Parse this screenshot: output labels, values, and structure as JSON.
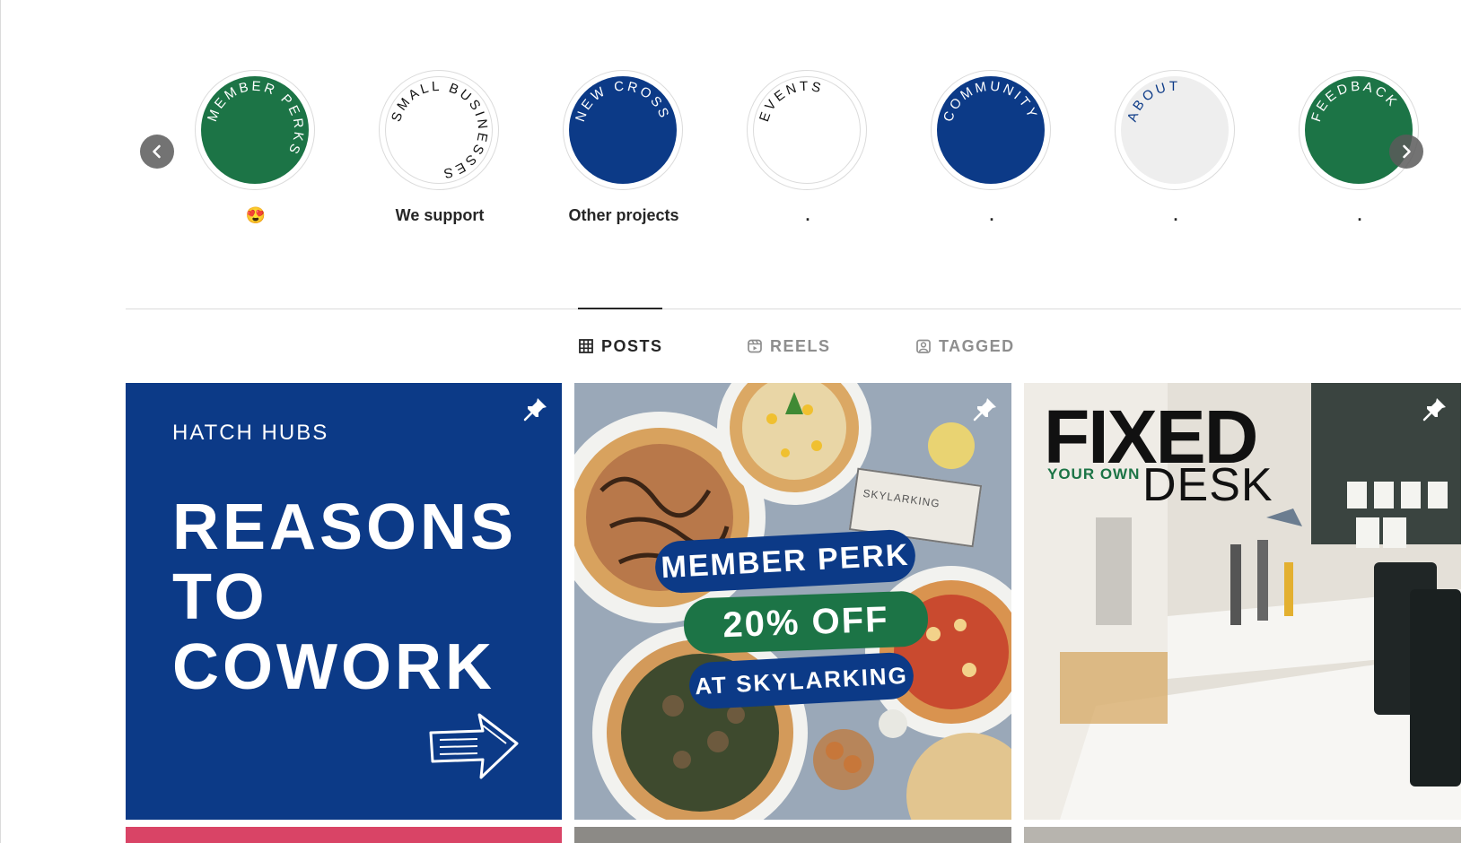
{
  "highlights": [
    {
      "ring_text": "MEMBER PERKS",
      "label": "😍",
      "color": "#1c7446",
      "text_color": "#ffffff"
    },
    {
      "ring_text": "SMALL BUSINESSES",
      "label": "We support",
      "color": "#ffffff",
      "text_color": "#111111"
    },
    {
      "ring_text": "NEW CROSS",
      "label": "Other projects",
      "color": "#0c3a87",
      "text_color": "#ffffff"
    },
    {
      "ring_text": "EVENTS",
      "label": ".",
      "color": "#ffffff",
      "text_color": "#111111"
    },
    {
      "ring_text": "COMMUNITY",
      "label": ".",
      "color": "#0c3a87",
      "text_color": "#ffffff"
    },
    {
      "ring_text": "ABOUT",
      "label": ".",
      "color": "#eeeeee",
      "text_color": "#0c3a87"
    },
    {
      "ring_text": "FEEDBACK",
      "label": ".",
      "color": "#1c7446",
      "text_color": "#ffffff"
    }
  ],
  "tabs": {
    "posts": "POSTS",
    "reels": "REELS",
    "tagged": "TAGGED",
    "active": "posts"
  },
  "posts": [
    {
      "pinned": true,
      "brand": "HATCH HUBS",
      "headline_lines": [
        "REASONS",
        "TO",
        "COWORK"
      ]
    },
    {
      "pinned": true,
      "line1": "MEMBER PERK",
      "line2": "20% OFF",
      "line3": "AT SKYLARKING",
      "box_label": "SKYLARKING"
    },
    {
      "pinned": true,
      "title": "FIXED",
      "subtitle": "YOUR OWN",
      "title2": "DESK"
    }
  ],
  "colors": {
    "brand_blue": "#0c3a87",
    "brand_green": "#1c7446",
    "text": "#262626",
    "muted": "#8e8e8e",
    "divider": "#dbdbdb"
  }
}
